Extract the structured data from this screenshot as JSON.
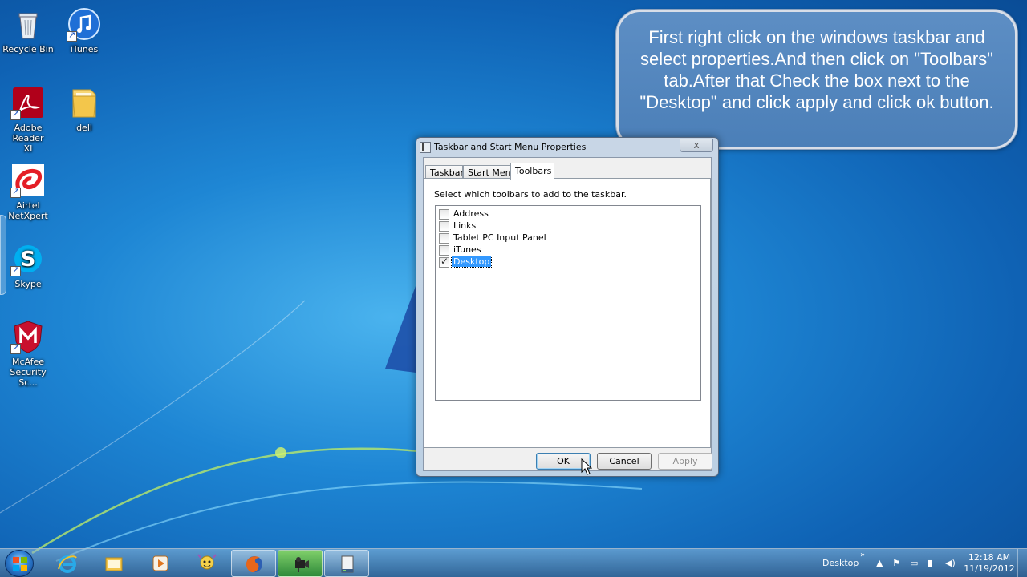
{
  "desktop": {
    "icons": [
      {
        "label": "Recycle Bin",
        "icon": "recycle-bin-icon"
      },
      {
        "label": "iTunes",
        "icon": "itunes-icon"
      },
      {
        "label": "Adobe Reader XI",
        "icon": "adobe-reader-icon"
      },
      {
        "label": "dell",
        "icon": "folder-icon"
      },
      {
        "label": "Airtel NetXpert",
        "icon": "airtel-icon"
      },
      {
        "label": "Skype",
        "icon": "skype-icon"
      },
      {
        "label": "McAfee Security Sc...",
        "icon": "mcafee-icon"
      }
    ]
  },
  "annotation": {
    "text": "First right click on the windows taskbar and select properties.And then click on \"Toolbars\" tab.After that Check the box next to the \"Desktop\" and click apply and click ok button."
  },
  "dialog": {
    "title": "Taskbar and Start Menu Properties",
    "close_label": "x",
    "tabs": [
      {
        "label": "Taskbar",
        "active": false
      },
      {
        "label": "Start Menu",
        "active": false
      },
      {
        "label": "Toolbars",
        "active": true
      }
    ],
    "description": "Select which toolbars to add to the taskbar.",
    "toolbars": [
      {
        "label": "Address",
        "checked": false,
        "selected": false
      },
      {
        "label": "Links",
        "checked": false,
        "selected": false
      },
      {
        "label": "Tablet PC Input Panel",
        "checked": false,
        "selected": false
      },
      {
        "label": "iTunes",
        "checked": false,
        "selected": false
      },
      {
        "label": "Desktop",
        "checked": true,
        "selected": true
      }
    ],
    "buttons": {
      "ok": "OK",
      "cancel": "Cancel",
      "apply": "Apply"
    }
  },
  "taskbar": {
    "pinned": [
      {
        "name": "internet-explorer",
        "open": false
      },
      {
        "name": "windows-explorer",
        "open": false
      },
      {
        "name": "media-player",
        "open": false
      },
      {
        "name": "messenger",
        "open": false
      },
      {
        "name": "firefox",
        "open": true
      },
      {
        "name": "video-recorder",
        "open": true
      },
      {
        "name": "taskbar-properties",
        "open": true
      }
    ],
    "toolbar_label": "Desktop",
    "toolbar_chevron": "»",
    "clock_time": "12:18 AM",
    "clock_date": "11/19/2012"
  },
  "colors": {
    "accent": "#3399ff",
    "balloon": "#5d8ec4",
    "desktop": "#1e86d4"
  }
}
